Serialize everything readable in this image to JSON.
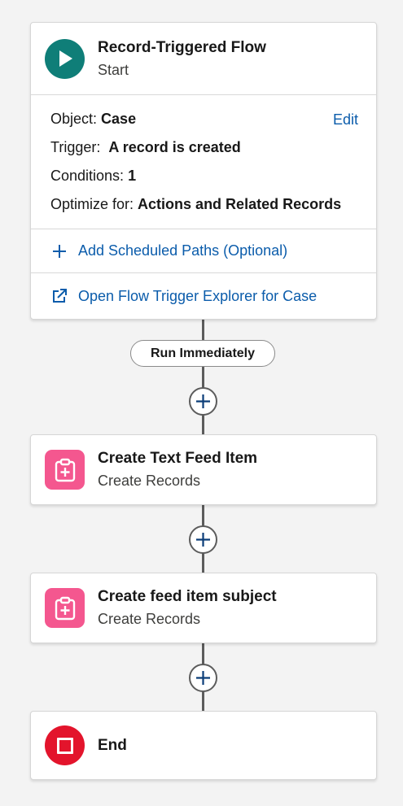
{
  "start": {
    "title": "Record-Triggered Flow",
    "subtitle": "Start",
    "icon": "play-icon",
    "color": "#0f7e78",
    "object_label": "Object:",
    "object_value": "Case",
    "edit_label": "Edit",
    "trigger_label": "Trigger:",
    "trigger_value": "A record is created",
    "conditions_label": "Conditions:",
    "conditions_value": "1",
    "optimize_label": "Optimize for:",
    "optimize_value": "Actions and Related Records",
    "scheduled_paths_label": "Add Scheduled Paths (Optional)",
    "explorer_label": "Open Flow Trigger Explorer for Case"
  },
  "run_immediately_label": "Run Immediately",
  "elements": [
    {
      "title": "Create Text Feed Item",
      "subtitle": "Create Records",
      "icon": "create-records-icon",
      "color": "#f4578f"
    },
    {
      "title": "Create feed item subject",
      "subtitle": "Create Records",
      "icon": "create-records-icon",
      "color": "#f4578f"
    }
  ],
  "end": {
    "title": "End",
    "icon": "stop-icon",
    "color": "#e3142c"
  },
  "colors": {
    "link": "#0b5cab",
    "connector": "#5c5c5c",
    "background": "#f3f3f3"
  }
}
